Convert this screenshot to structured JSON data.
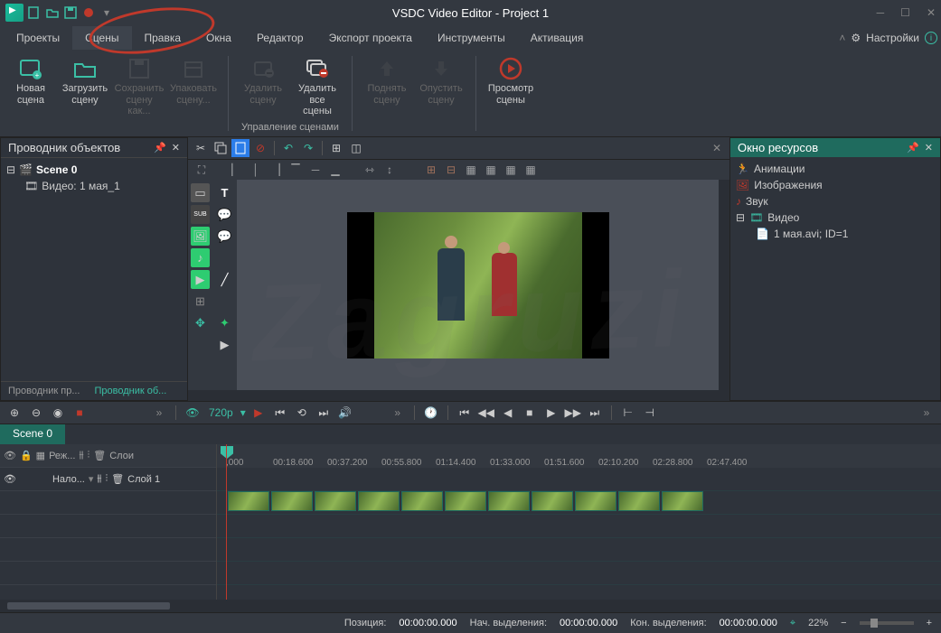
{
  "app": {
    "title": "VSDC Video Editor - Project 1"
  },
  "menu": {
    "items": [
      "Проекты",
      "Сцены",
      "Правка",
      "Окна",
      "Редактор",
      "Экспорт проекта",
      "Инструменты",
      "Активация"
    ],
    "active_index": 1,
    "settings": "Настройки"
  },
  "ribbon": {
    "new_scene": "Новая\nсцена",
    "load_scene": "Загрузить\nсцену",
    "save_scene": "Сохранить\nсцену как...",
    "pack_scene": "Упаковать\nсцену...",
    "delete_scene": "Удалить\nсцену",
    "delete_all": "Удалить\nвсе сцены",
    "move_up": "Поднять\nсцену",
    "move_down": "Опустить\nсцену",
    "preview": "Просмотр\nсцены",
    "group_label": "Управление сценами"
  },
  "explorer": {
    "title": "Проводник объектов",
    "scene": "Scene 0",
    "video_item": "Видео: 1 мая_1",
    "tab1": "Проводник пр...",
    "tab2": "Проводник об..."
  },
  "resources": {
    "title": "Окно ресурсов",
    "animations": "Анимации",
    "images": "Изображения",
    "sound": "Звук",
    "video": "Видео",
    "video_file": "1 мая.avi; ID=1"
  },
  "playbar": {
    "resolution": "720p"
  },
  "timeline": {
    "tab": "Scene 0",
    "hdr_mode": "Реж...",
    "hdr_layers": "Слои",
    "row_overlay": "Нало...",
    "row_layer": "Слой 1",
    "ticks": [
      ",000",
      "00:18.600",
      "00:37.200",
      "00:55.800",
      "01:14.400",
      "01:33.000",
      "01:51.600",
      "02:10.200",
      "02:28.800",
      "02:47.400"
    ]
  },
  "status": {
    "position_label": "Позиция:",
    "position_value": "00:00:00.000",
    "sel_start_label": "Нач. выделения:",
    "sel_start_value": "00:00:00.000",
    "sel_end_label": "Кон. выделения:",
    "sel_end_value": "00:00:00.000",
    "zoom": "22%"
  },
  "colors": {
    "accent": "#1f6b5e",
    "teal": "#3bbfa5",
    "red": "#c0392b"
  }
}
